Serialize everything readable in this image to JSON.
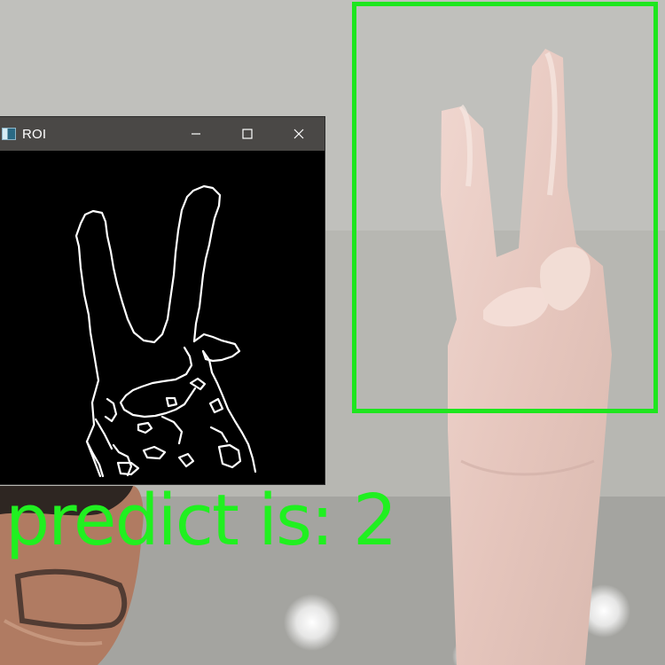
{
  "roi_window": {
    "title": "ROI",
    "icon": "app-icon",
    "controls": [
      "minimize-icon",
      "maximize-icon",
      "close-icon"
    ]
  },
  "prediction": {
    "label": "predict is:",
    "value": "2",
    "text": "predict is: 2",
    "color": "#20f020"
  },
  "detection_box": {
    "color": "#1ee61e"
  },
  "colors": {
    "titlebar": "#4a4846",
    "roi_background": "#000000",
    "edge_lines": "#ffffff"
  }
}
